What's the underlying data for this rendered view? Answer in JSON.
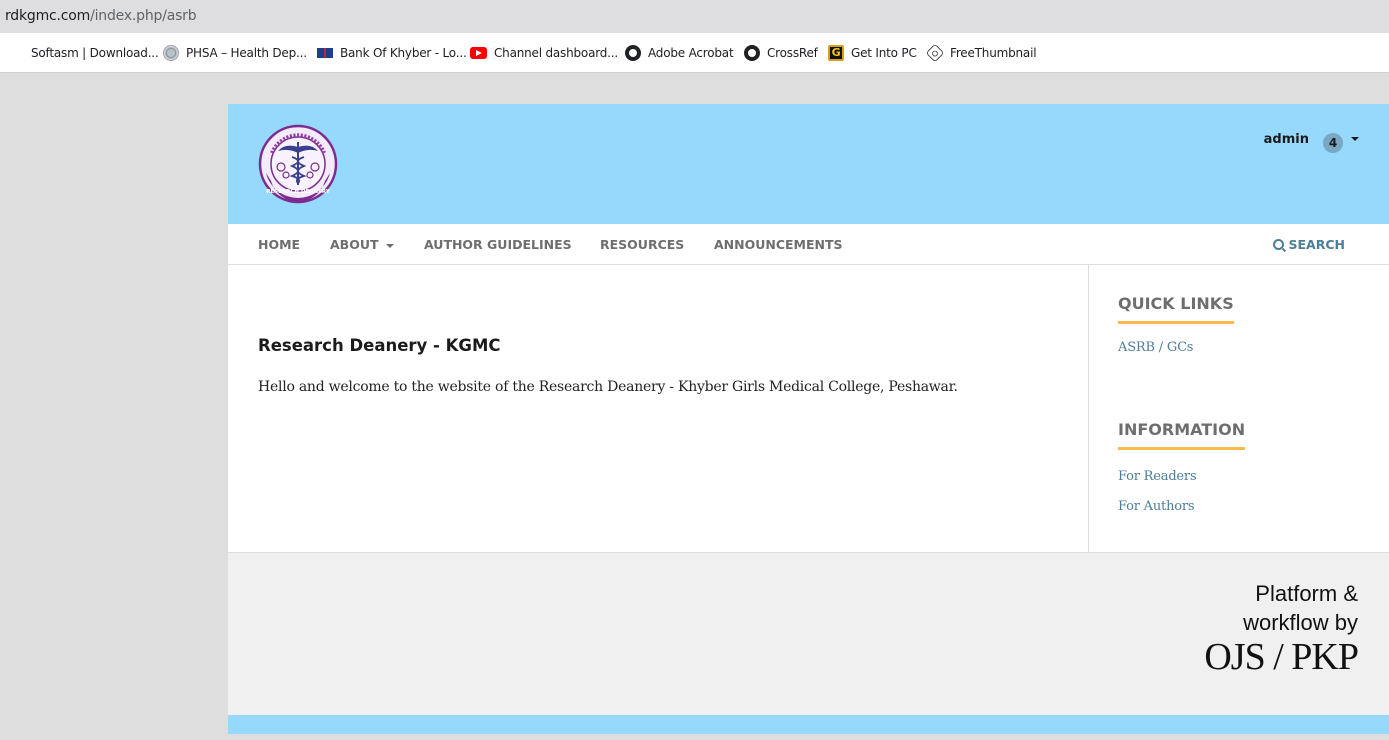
{
  "browser": {
    "url_domain": "rdkgmc.com",
    "url_path": "/index.php/asrb",
    "bookmarks": [
      {
        "label": "Softasm | Download...",
        "icon": "none"
      },
      {
        "label": "PHSA – Health Dep...",
        "icon": "phsa-logo-icon"
      },
      {
        "label": "Bank Of Khyber - Lo...",
        "icon": "bank-of-khyber-icon"
      },
      {
        "label": "Channel dashboard...",
        "icon": "youtube-icon"
      },
      {
        "label": "Adobe Acrobat",
        "icon": "globe-icon"
      },
      {
        "label": "CrossRef",
        "icon": "globe-icon"
      },
      {
        "label": "Get Into PC",
        "icon": "g-logo-icon"
      },
      {
        "label": "FreeThumbnail",
        "icon": "hexagon-icon"
      }
    ]
  },
  "header": {
    "user": "admin",
    "notifications": "4",
    "logo_alt": "KHYBER GIRLS MEDICAL COLLEGE RESEARCH DEANERY",
    "bg_color": "#97d9fd"
  },
  "nav": {
    "items": [
      "HOME",
      "ABOUT",
      "AUTHOR GUIDELINES",
      "RESOURCES",
      "ANNOUNCEMENTS"
    ],
    "search": "SEARCH"
  },
  "main": {
    "title": "Research Deanery - KGMC",
    "text": "Hello and welcome to the website of the Research Deanery - Khyber Girls Medical College, Peshawar."
  },
  "sidebar": {
    "quick_links_title": "QUICK LINKS",
    "quick_links": [
      "ASRB / GCs"
    ],
    "information_title": "INFORMATION",
    "information_links": [
      "For Readers",
      "For Authors"
    ],
    "accent_color": "#f7bc4a"
  },
  "footer": {
    "line1": "Platform &",
    "line2": "workflow by",
    "line3": "OJS / PKP"
  }
}
